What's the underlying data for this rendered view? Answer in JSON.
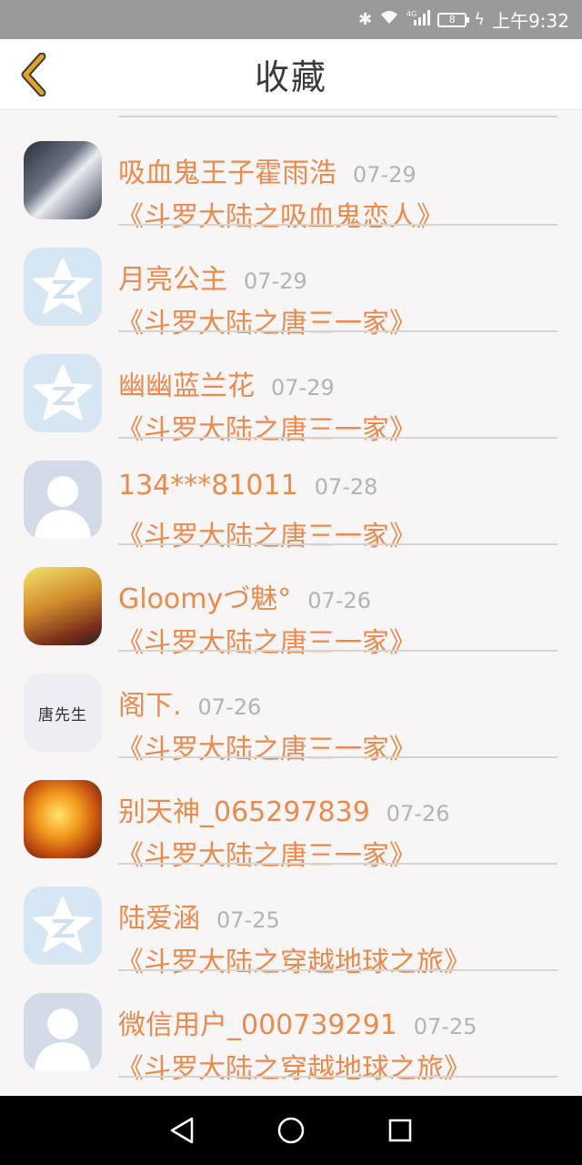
{
  "status_bar": {
    "network": "4G",
    "battery": "8",
    "time": "上午9:32"
  },
  "header": {
    "title": "收藏",
    "back_icon": "chevron-left-icon"
  },
  "items": [
    {
      "name": "吸血鬼王子霍雨浩",
      "date": "07-29",
      "book": "《斗罗大陆之吸血鬼恋人》",
      "avatar": "anime1"
    },
    {
      "name": "月亮公主",
      "date": "07-29",
      "book": "《斗罗大陆之唐三一家》",
      "avatar": "qq"
    },
    {
      "name": "幽幽蓝兰花",
      "date": "07-29",
      "book": "《斗罗大陆之唐三一家》",
      "avatar": "qq"
    },
    {
      "name": "134***81011",
      "date": "07-28",
      "book": "《斗罗大陆之唐三一家》",
      "avatar": "person"
    },
    {
      "name": "Gloomyづ魅°",
      "date": "07-26",
      "book": "《斗罗大陆之唐三一家》",
      "avatar": "anime2"
    },
    {
      "name": "阁下.",
      "date": "07-26",
      "book": "《斗罗大陆之唐三一家》",
      "avatar": "text",
      "avatar_text": "唐先生"
    },
    {
      "name": "别天神_065297839",
      "date": "07-26",
      "book": "《斗罗大陆之唐三一家》",
      "avatar": "anime3"
    },
    {
      "name": "陆爱涵",
      "date": "07-25",
      "book": "《斗罗大陆之穿越地球之旅》",
      "avatar": "qq"
    },
    {
      "name": "微信用户_000739291",
      "date": "07-25",
      "book": "《斗罗大陆之穿越地球之旅》",
      "avatar": "person"
    }
  ],
  "colors": {
    "accent": "#ea8a4d",
    "date": "#b3b3b3",
    "back_icon": "#e1a42a"
  }
}
